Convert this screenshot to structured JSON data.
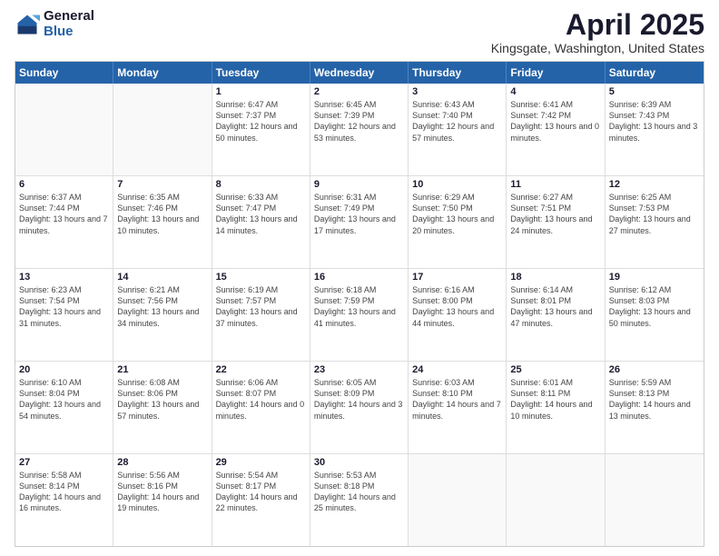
{
  "logo": {
    "general": "General",
    "blue": "Blue"
  },
  "title": "April 2025",
  "subtitle": "Kingsgate, Washington, United States",
  "header_days": [
    "Sunday",
    "Monday",
    "Tuesday",
    "Wednesday",
    "Thursday",
    "Friday",
    "Saturday"
  ],
  "weeks": [
    [
      {
        "day": "",
        "sunrise": "",
        "sunset": "",
        "daylight": ""
      },
      {
        "day": "",
        "sunrise": "",
        "sunset": "",
        "daylight": ""
      },
      {
        "day": "1",
        "sunrise": "Sunrise: 6:47 AM",
        "sunset": "Sunset: 7:37 PM",
        "daylight": "Daylight: 12 hours and 50 minutes."
      },
      {
        "day": "2",
        "sunrise": "Sunrise: 6:45 AM",
        "sunset": "Sunset: 7:39 PM",
        "daylight": "Daylight: 12 hours and 53 minutes."
      },
      {
        "day": "3",
        "sunrise": "Sunrise: 6:43 AM",
        "sunset": "Sunset: 7:40 PM",
        "daylight": "Daylight: 12 hours and 57 minutes."
      },
      {
        "day": "4",
        "sunrise": "Sunrise: 6:41 AM",
        "sunset": "Sunset: 7:42 PM",
        "daylight": "Daylight: 13 hours and 0 minutes."
      },
      {
        "day": "5",
        "sunrise": "Sunrise: 6:39 AM",
        "sunset": "Sunset: 7:43 PM",
        "daylight": "Daylight: 13 hours and 3 minutes."
      }
    ],
    [
      {
        "day": "6",
        "sunrise": "Sunrise: 6:37 AM",
        "sunset": "Sunset: 7:44 PM",
        "daylight": "Daylight: 13 hours and 7 minutes."
      },
      {
        "day": "7",
        "sunrise": "Sunrise: 6:35 AM",
        "sunset": "Sunset: 7:46 PM",
        "daylight": "Daylight: 13 hours and 10 minutes."
      },
      {
        "day": "8",
        "sunrise": "Sunrise: 6:33 AM",
        "sunset": "Sunset: 7:47 PM",
        "daylight": "Daylight: 13 hours and 14 minutes."
      },
      {
        "day": "9",
        "sunrise": "Sunrise: 6:31 AM",
        "sunset": "Sunset: 7:49 PM",
        "daylight": "Daylight: 13 hours and 17 minutes."
      },
      {
        "day": "10",
        "sunrise": "Sunrise: 6:29 AM",
        "sunset": "Sunset: 7:50 PM",
        "daylight": "Daylight: 13 hours and 20 minutes."
      },
      {
        "day": "11",
        "sunrise": "Sunrise: 6:27 AM",
        "sunset": "Sunset: 7:51 PM",
        "daylight": "Daylight: 13 hours and 24 minutes."
      },
      {
        "day": "12",
        "sunrise": "Sunrise: 6:25 AM",
        "sunset": "Sunset: 7:53 PM",
        "daylight": "Daylight: 13 hours and 27 minutes."
      }
    ],
    [
      {
        "day": "13",
        "sunrise": "Sunrise: 6:23 AM",
        "sunset": "Sunset: 7:54 PM",
        "daylight": "Daylight: 13 hours and 31 minutes."
      },
      {
        "day": "14",
        "sunrise": "Sunrise: 6:21 AM",
        "sunset": "Sunset: 7:56 PM",
        "daylight": "Daylight: 13 hours and 34 minutes."
      },
      {
        "day": "15",
        "sunrise": "Sunrise: 6:19 AM",
        "sunset": "Sunset: 7:57 PM",
        "daylight": "Daylight: 13 hours and 37 minutes."
      },
      {
        "day": "16",
        "sunrise": "Sunrise: 6:18 AM",
        "sunset": "Sunset: 7:59 PM",
        "daylight": "Daylight: 13 hours and 41 minutes."
      },
      {
        "day": "17",
        "sunrise": "Sunrise: 6:16 AM",
        "sunset": "Sunset: 8:00 PM",
        "daylight": "Daylight: 13 hours and 44 minutes."
      },
      {
        "day": "18",
        "sunrise": "Sunrise: 6:14 AM",
        "sunset": "Sunset: 8:01 PM",
        "daylight": "Daylight: 13 hours and 47 minutes."
      },
      {
        "day": "19",
        "sunrise": "Sunrise: 6:12 AM",
        "sunset": "Sunset: 8:03 PM",
        "daylight": "Daylight: 13 hours and 50 minutes."
      }
    ],
    [
      {
        "day": "20",
        "sunrise": "Sunrise: 6:10 AM",
        "sunset": "Sunset: 8:04 PM",
        "daylight": "Daylight: 13 hours and 54 minutes."
      },
      {
        "day": "21",
        "sunrise": "Sunrise: 6:08 AM",
        "sunset": "Sunset: 8:06 PM",
        "daylight": "Daylight: 13 hours and 57 minutes."
      },
      {
        "day": "22",
        "sunrise": "Sunrise: 6:06 AM",
        "sunset": "Sunset: 8:07 PM",
        "daylight": "Daylight: 14 hours and 0 minutes."
      },
      {
        "day": "23",
        "sunrise": "Sunrise: 6:05 AM",
        "sunset": "Sunset: 8:09 PM",
        "daylight": "Daylight: 14 hours and 3 minutes."
      },
      {
        "day": "24",
        "sunrise": "Sunrise: 6:03 AM",
        "sunset": "Sunset: 8:10 PM",
        "daylight": "Daylight: 14 hours and 7 minutes."
      },
      {
        "day": "25",
        "sunrise": "Sunrise: 6:01 AM",
        "sunset": "Sunset: 8:11 PM",
        "daylight": "Daylight: 14 hours and 10 minutes."
      },
      {
        "day": "26",
        "sunrise": "Sunrise: 5:59 AM",
        "sunset": "Sunset: 8:13 PM",
        "daylight": "Daylight: 14 hours and 13 minutes."
      }
    ],
    [
      {
        "day": "27",
        "sunrise": "Sunrise: 5:58 AM",
        "sunset": "Sunset: 8:14 PM",
        "daylight": "Daylight: 14 hours and 16 minutes."
      },
      {
        "day": "28",
        "sunrise": "Sunrise: 5:56 AM",
        "sunset": "Sunset: 8:16 PM",
        "daylight": "Daylight: 14 hours and 19 minutes."
      },
      {
        "day": "29",
        "sunrise": "Sunrise: 5:54 AM",
        "sunset": "Sunset: 8:17 PM",
        "daylight": "Daylight: 14 hours and 22 minutes."
      },
      {
        "day": "30",
        "sunrise": "Sunrise: 5:53 AM",
        "sunset": "Sunset: 8:18 PM",
        "daylight": "Daylight: 14 hours and 25 minutes."
      },
      {
        "day": "",
        "sunrise": "",
        "sunset": "",
        "daylight": ""
      },
      {
        "day": "",
        "sunrise": "",
        "sunset": "",
        "daylight": ""
      },
      {
        "day": "",
        "sunrise": "",
        "sunset": "",
        "daylight": ""
      }
    ]
  ]
}
